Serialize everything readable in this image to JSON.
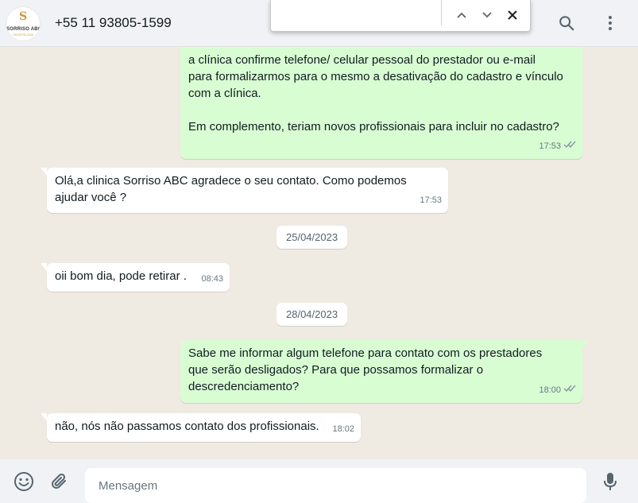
{
  "header": {
    "contact_name": "+55 11 93805-1599",
    "avatar": {
      "brand": "SORRISO ABC",
      "sub": "ODONTOLOGIA",
      "glyph": "S"
    },
    "search_icon": "search-icon",
    "menu_icon": "kebab-menu-icon"
  },
  "findbar": {
    "query": "",
    "count": "",
    "prev_icon": "chevron-up-icon",
    "next_icon": "chevron-down-icon",
    "close_icon": "close-icon"
  },
  "messages": [
    {
      "direction": "out",
      "text": "a clínica confirme telefone/ celular pessoal do prestador ou e-mail\npara formalizarmos para o mesmo a desativação do cadastro e vínculo\ncom a clínica.\n\nEm complemento, teriam novos profissionais para incluir no cadastro?",
      "time": "17:53",
      "status": "read"
    },
    {
      "direction": "in",
      "text": "Olá,a clinica Sorriso ABC agradece o seu contato. Como podemos\najudar você ?",
      "time": "17:53"
    },
    {
      "type": "date",
      "label": "25/04/2023"
    },
    {
      "direction": "in",
      "text": "oii bom dia, pode retirar .",
      "time": "08:43"
    },
    {
      "type": "date",
      "label": "28/04/2023"
    },
    {
      "direction": "out",
      "text": "Sabe me informar algum telefone para contato com os prestadores\nque serão desligados? Para que possamos formalizar o\ndescredenciamento?",
      "time": "18:00",
      "status": "read"
    },
    {
      "direction": "in",
      "text": "não, nós não passamos contato dos profissionais.",
      "time": "18:02"
    }
  ],
  "footer": {
    "placeholder": "Mensagem",
    "emoji_icon": "emoji-icon",
    "attach_icon": "paperclip-icon",
    "mic_icon": "microphone-icon"
  },
  "colors": {
    "outgoing_bubble": "#d9fdd3",
    "incoming_bubble": "#ffffff",
    "chat_background": "#efeae2",
    "read_ticks": "#8696a0"
  }
}
